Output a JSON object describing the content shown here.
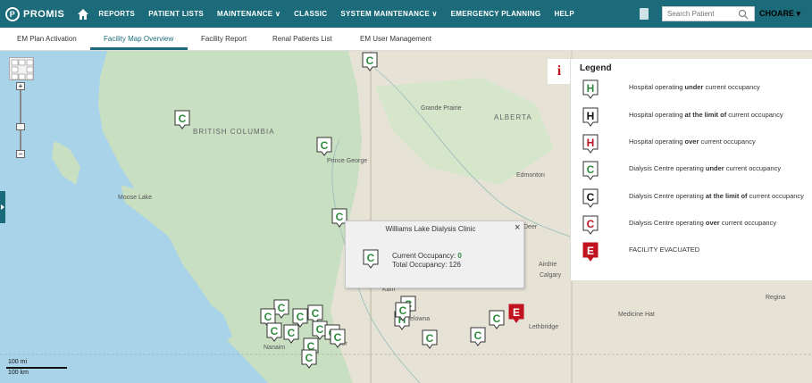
{
  "app": {
    "name": "PROMIS",
    "logo_letter": "P"
  },
  "nav": {
    "items": [
      "REPORTS",
      "PATIENT LISTS",
      "MAINTENANCE ∨",
      "CLASSIC",
      "SYSTEM MAINTENANCE ∨",
      "EMERGENCY PLANNING",
      "HELP"
    ]
  },
  "search": {
    "placeholder": "Search Patient"
  },
  "user": {
    "name": "CHOARE ▾"
  },
  "tabs": [
    "EM Plan Activation",
    "Facility Map Overview",
    "Facility Report",
    "Renal Patients List",
    "EM User Management"
  ],
  "active_tab": "Facility Map Overview",
  "map": {
    "labels": [
      "Grande Prairie",
      "ALBERTA",
      "BRITISH COLUMBIA",
      "Prince George",
      "Edmonton",
      "Deer",
      "Airdrie",
      "Calgary",
      "Moose Lake",
      "Kam",
      "elowna",
      "Nanaim",
      "ver",
      "Lethbridge",
      "Medicine Hat",
      "Regina"
    ],
    "scale": {
      "top": "100 mi",
      "bottom": "100 km"
    }
  },
  "popup": {
    "title": "Williams Lake Dialysis Clinic",
    "close": "×",
    "current_label": "Current Occupancy: ",
    "current_value": "0",
    "total": "Total Occupancy: 126"
  },
  "legend": {
    "title": "Legend",
    "info_icon": "i",
    "rows": [
      {
        "letter": "H",
        "color": "#2e8b3e",
        "pre": "Hospital operating ",
        "bold": "under",
        "post": " current occupancy"
      },
      {
        "letter": "H",
        "color": "#111111",
        "pre": "Hospital operating ",
        "bold": "at the limit of",
        "post": " current occupancy"
      },
      {
        "letter": "H",
        "color": "#c1121f",
        "pre": "Hospital operating ",
        "bold": "over",
        "post": " current occupancy"
      },
      {
        "letter": "C",
        "color": "#2e8b3e",
        "pre": "Dialysis Centre operating ",
        "bold": "under",
        "post": " current occupancy"
      },
      {
        "letter": "C",
        "color": "#111111",
        "pre": "Dialysis Centre operating ",
        "bold": "at the limit of",
        "post": " current occupancy"
      },
      {
        "letter": "C",
        "color": "#c1121f",
        "pre": "Dialysis Centre operating ",
        "bold": "over",
        "post": " current occupancy"
      },
      {
        "letter": "E",
        "color": "#c1121f",
        "pre": "FACILITY EVACUATED",
        "bold": "",
        "post": ""
      }
    ]
  },
  "markers": [
    {
      "letter": "C",
      "color": "#2e8b3e"
    },
    {
      "letter": "C",
      "color": "#2e8b3e"
    },
    {
      "letter": "C",
      "color": "#2e8b3e"
    },
    {
      "letter": "C",
      "color": "#2e8b3e"
    },
    {
      "letter": "C",
      "color": "#2e8b3e"
    },
    {
      "letter": "C",
      "color": "#2e8b3e"
    },
    {
      "letter": "C",
      "color": "#2e8b3e"
    },
    {
      "letter": "C",
      "color": "#2e8b3e"
    },
    {
      "letter": "C",
      "color": "#2e8b3e"
    },
    {
      "letter": "C",
      "color": "#2e8b3e"
    },
    {
      "letter": "C",
      "color": "#2e8b3e"
    },
    {
      "letter": "C",
      "color": "#2e8b3e"
    },
    {
      "letter": "C",
      "color": "#2e8b3e"
    },
    {
      "letter": "C",
      "color": "#2e8b3e"
    },
    {
      "letter": "C",
      "color": "#2e8b3e"
    },
    {
      "letter": "H",
      "color": "#2e8b3e"
    },
    {
      "letter": "C",
      "color": "#2e8b3e"
    },
    {
      "letter": "C",
      "color": "#2e8b3e"
    },
    {
      "letter": "C",
      "color": "#2e8b3e"
    },
    {
      "letter": "C",
      "color": "#2e8b3e"
    },
    {
      "letter": "C",
      "color": "#2e8b3e"
    },
    {
      "letter": "E",
      "color": "#c1121f"
    }
  ]
}
